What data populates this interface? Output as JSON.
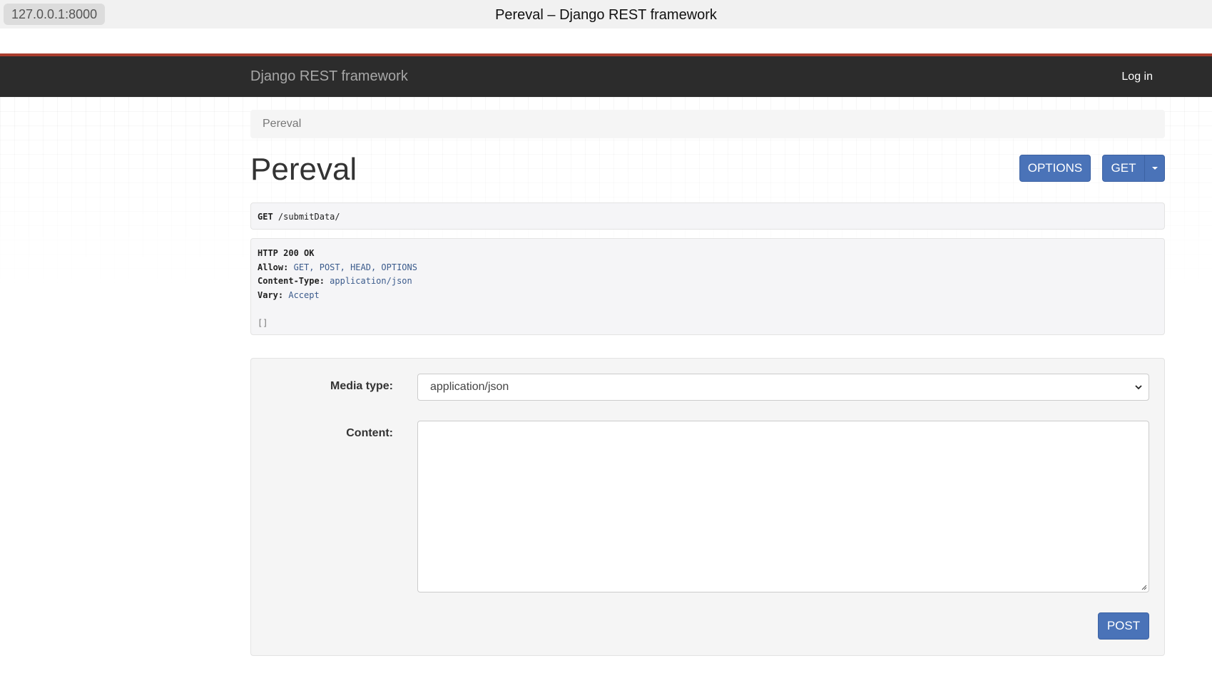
{
  "browser": {
    "url": "127.0.0.1:8000",
    "window_title": "Pereval – Django REST framework"
  },
  "navbar": {
    "brand": "Django REST framework",
    "login": "Log in",
    "accent_color": "#a93d2e",
    "background_color": "#2c2c2c"
  },
  "breadcrumb": {
    "item": "Pereval"
  },
  "page": {
    "title": "Pereval",
    "buttons": {
      "options": "OPTIONS",
      "get": "GET"
    },
    "button_color": "#4a73b8"
  },
  "request": {
    "method": "GET",
    "path": "/submitData/"
  },
  "response": {
    "status": "HTTP 200 OK",
    "headers": [
      {
        "name": "Allow:",
        "value": "GET, POST, HEAD, OPTIONS"
      },
      {
        "name": "Content-Type:",
        "value": "application/json"
      },
      {
        "name": "Vary:",
        "value": "Accept"
      }
    ],
    "body": "[]"
  },
  "form": {
    "media_type_label": "Media type:",
    "media_type_value": "application/json",
    "content_label": "Content:",
    "content_value": "",
    "post_label": "POST"
  }
}
